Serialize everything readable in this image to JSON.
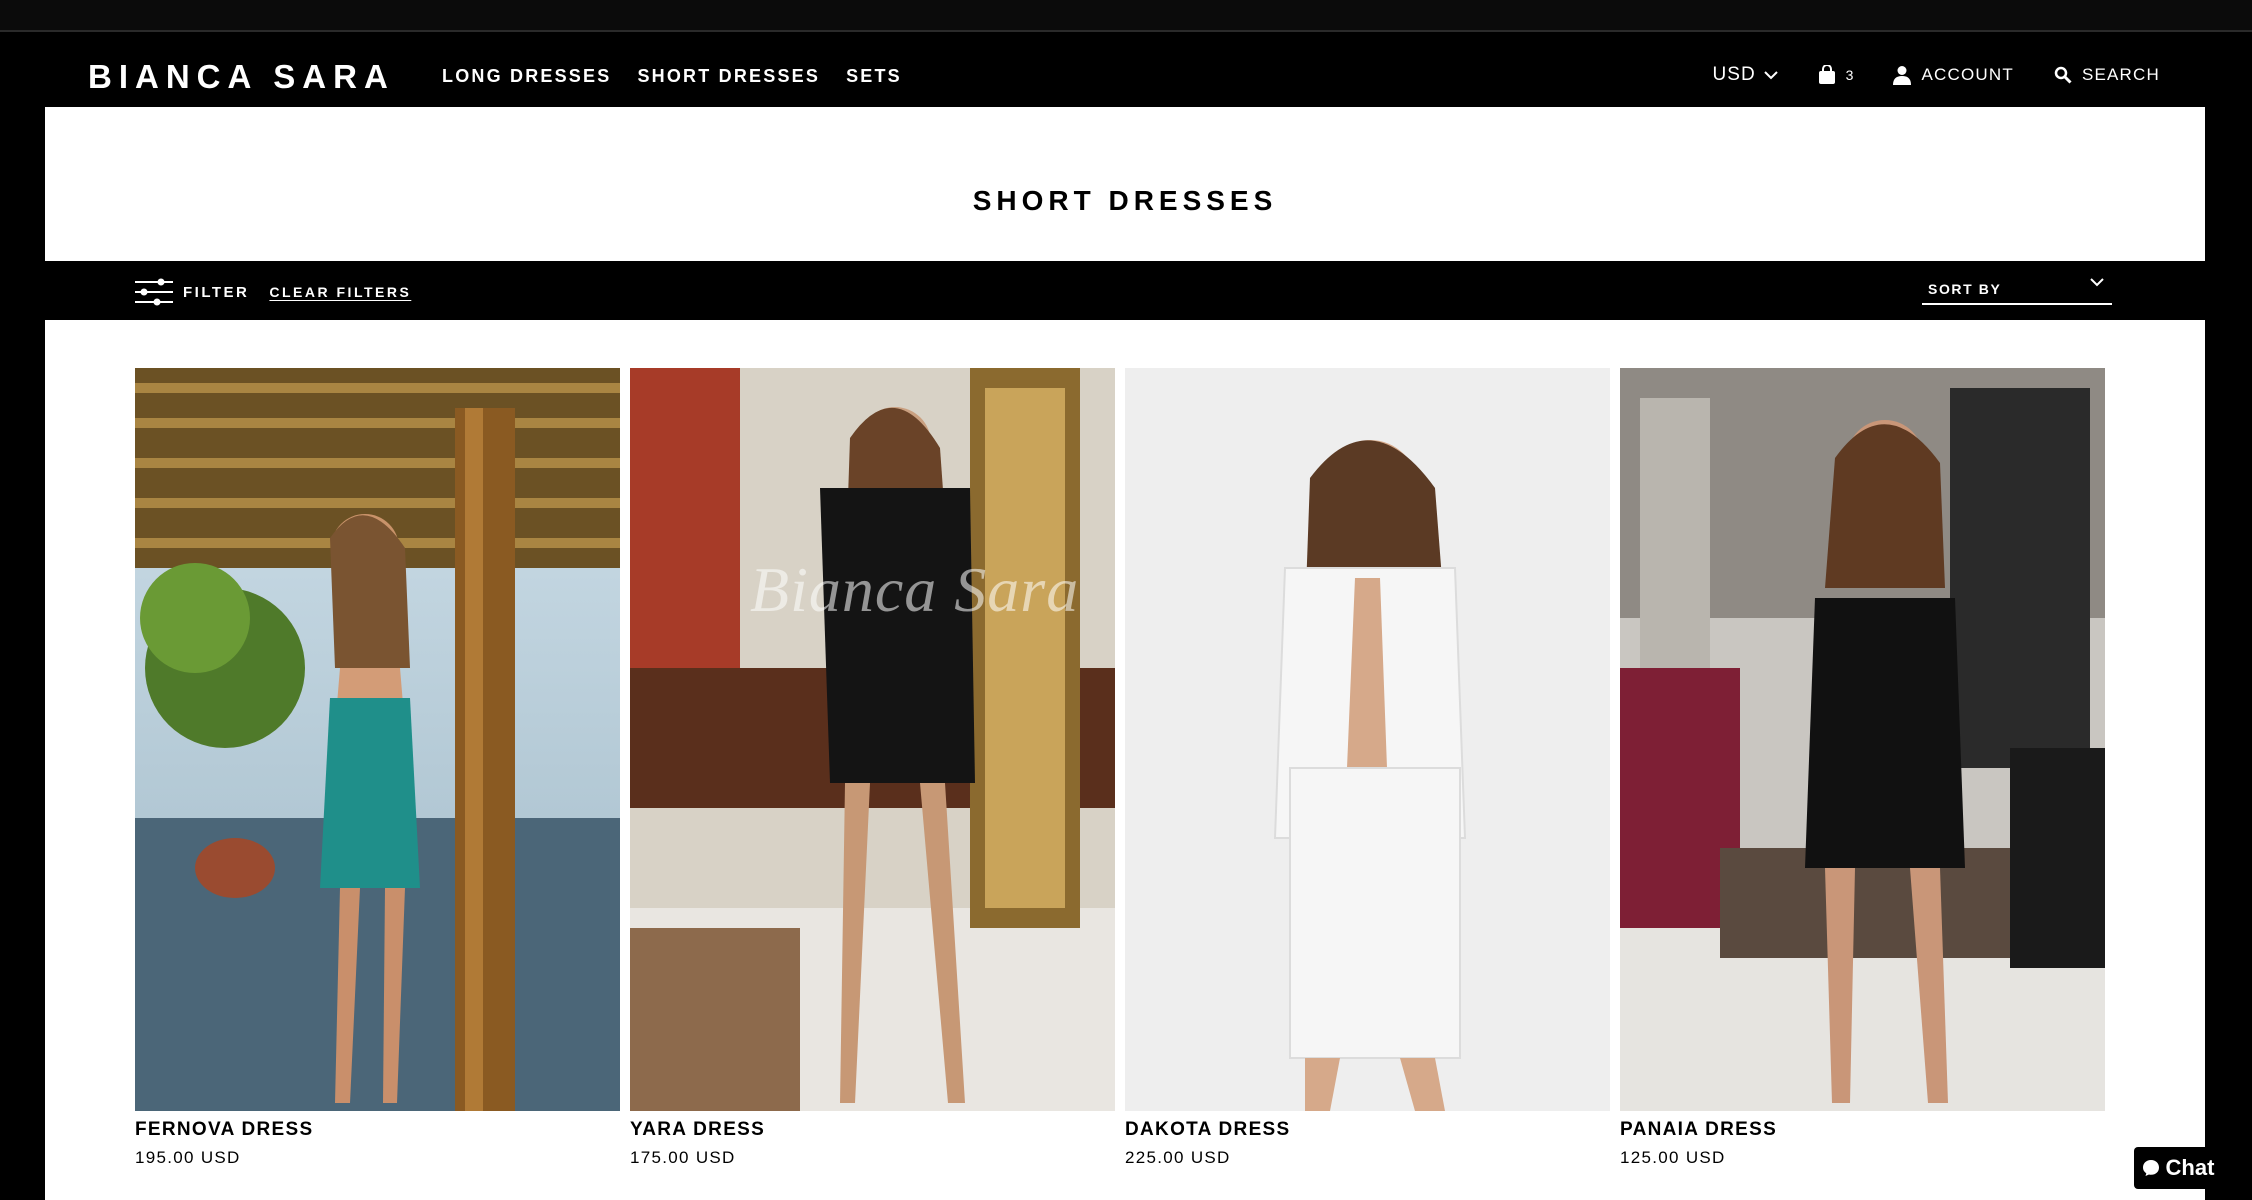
{
  "brand": "BIANCA SARA",
  "nav": [
    "LONG DRESSES",
    "SHORT DRESSES",
    "SETS"
  ],
  "header_right": {
    "currency": "USD",
    "cart_count": "3",
    "account": "ACCOUNT",
    "search": "SEARCH"
  },
  "page_title": "SHORT DRESSES",
  "filter": {
    "label": "FILTER",
    "clear": "CLEAR FILTERS",
    "sort_label": "SORT BY"
  },
  "products": [
    {
      "name": "FERNOVA DRESS",
      "price": "195.00 USD",
      "dress_color": "#1f8f8a"
    },
    {
      "name": "YARA DRESS",
      "price": "175.00 USD",
      "dress_color": "#141414"
    },
    {
      "name": "DAKOTA DRESS",
      "price": "225.00 USD",
      "dress_color": "#f6f6f6"
    },
    {
      "name": "PANAIA DRESS",
      "price": "125.00 USD",
      "dress_color": "#111111"
    }
  ],
  "watermark": "Bianca Sara",
  "chat_label": "Chat",
  "colors": {
    "background": "#000000",
    "panel": "#ffffff",
    "text": "#000000"
  }
}
